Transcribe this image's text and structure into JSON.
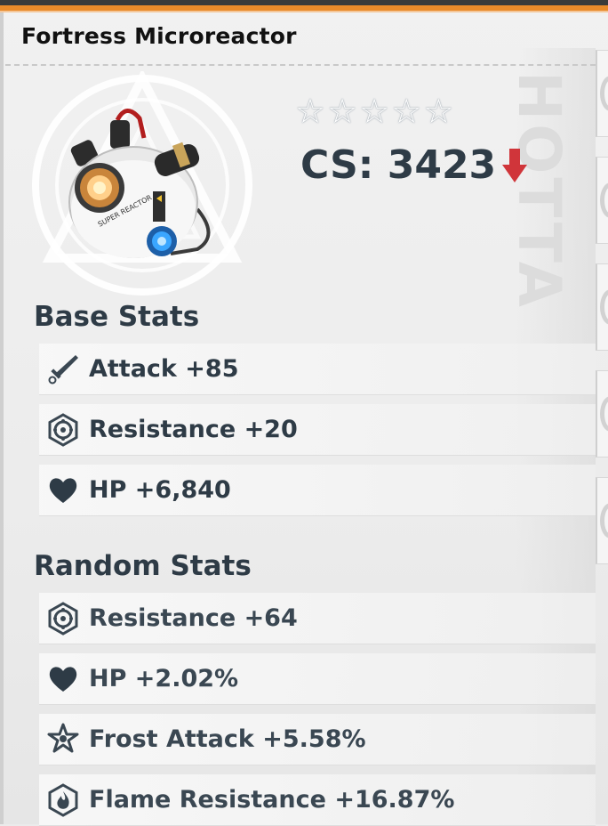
{
  "item": {
    "name": "Fortress Microreactor",
    "image_label": "SUPER REACTOR",
    "stars": [
      "☆",
      "☆",
      "☆",
      "☆",
      "☆"
    ],
    "cs_label": "CS: 3423",
    "cs_trend": "down"
  },
  "base_stats": {
    "title": "Base Stats",
    "rows": [
      {
        "icon": "sword-icon",
        "text": "Attack +85"
      },
      {
        "icon": "resistance-icon",
        "text": "Resistance +20"
      },
      {
        "icon": "heart-icon",
        "text": "HP +6,840"
      }
    ]
  },
  "random_stats": {
    "title": "Random Stats",
    "rows": [
      {
        "icon": "resistance-icon",
        "text": "Resistance +64"
      },
      {
        "icon": "heart-icon",
        "text": "HP +2.02%"
      },
      {
        "icon": "frost-icon",
        "text": "Frost Attack +5.58%"
      },
      {
        "icon": "flame-icon",
        "text": "Flame Resistance +16.87%"
      }
    ]
  },
  "colors": {
    "accent": "#e98a2a",
    "text": "#2e3b46",
    "down_arrow": "#d0353a"
  }
}
